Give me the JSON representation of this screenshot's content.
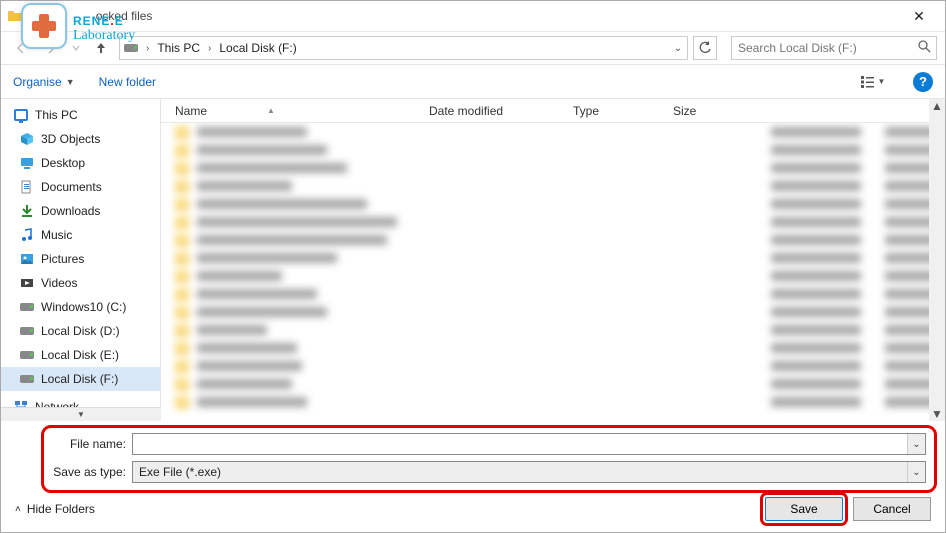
{
  "window": {
    "title_suffix": "ocked files",
    "close": "✕"
  },
  "watermark": {
    "line1_a": "RENE",
    "line1_dot": ".",
    "line1_b": "E",
    "line2": "Laboratory"
  },
  "nav": {
    "crumb1": "This PC",
    "crumb2": "Local Disk (F:)",
    "search_placeholder": "Search Local Disk (F:)"
  },
  "toolbar": {
    "organise": "Organise",
    "newfolder": "New folder"
  },
  "columns": {
    "name": "Name",
    "date": "Date modified",
    "type": "Type",
    "size": "Size"
  },
  "tree": {
    "root": "This PC",
    "items": [
      {
        "label": "3D Objects",
        "icon": "cube"
      },
      {
        "label": "Desktop",
        "icon": "desktop"
      },
      {
        "label": "Documents",
        "icon": "doc"
      },
      {
        "label": "Downloads",
        "icon": "download"
      },
      {
        "label": "Music",
        "icon": "music"
      },
      {
        "label": "Pictures",
        "icon": "pictures"
      },
      {
        "label": "Videos",
        "icon": "videos"
      },
      {
        "label": "Windows10 (C:)",
        "icon": "drive"
      },
      {
        "label": "Local Disk (D:)",
        "icon": "drive"
      },
      {
        "label": "Local Disk (E:)",
        "icon": "drive"
      },
      {
        "label": "Local Disk (F:)",
        "icon": "drive",
        "selected": true
      }
    ],
    "network": "Network"
  },
  "fields": {
    "filename_label": "File name:",
    "filename_value": "",
    "type_label": "Save as type:",
    "type_value": "Exe File (*.exe)"
  },
  "bottom": {
    "hide": "Hide Folders",
    "save": "Save",
    "cancel": "Cancel"
  }
}
